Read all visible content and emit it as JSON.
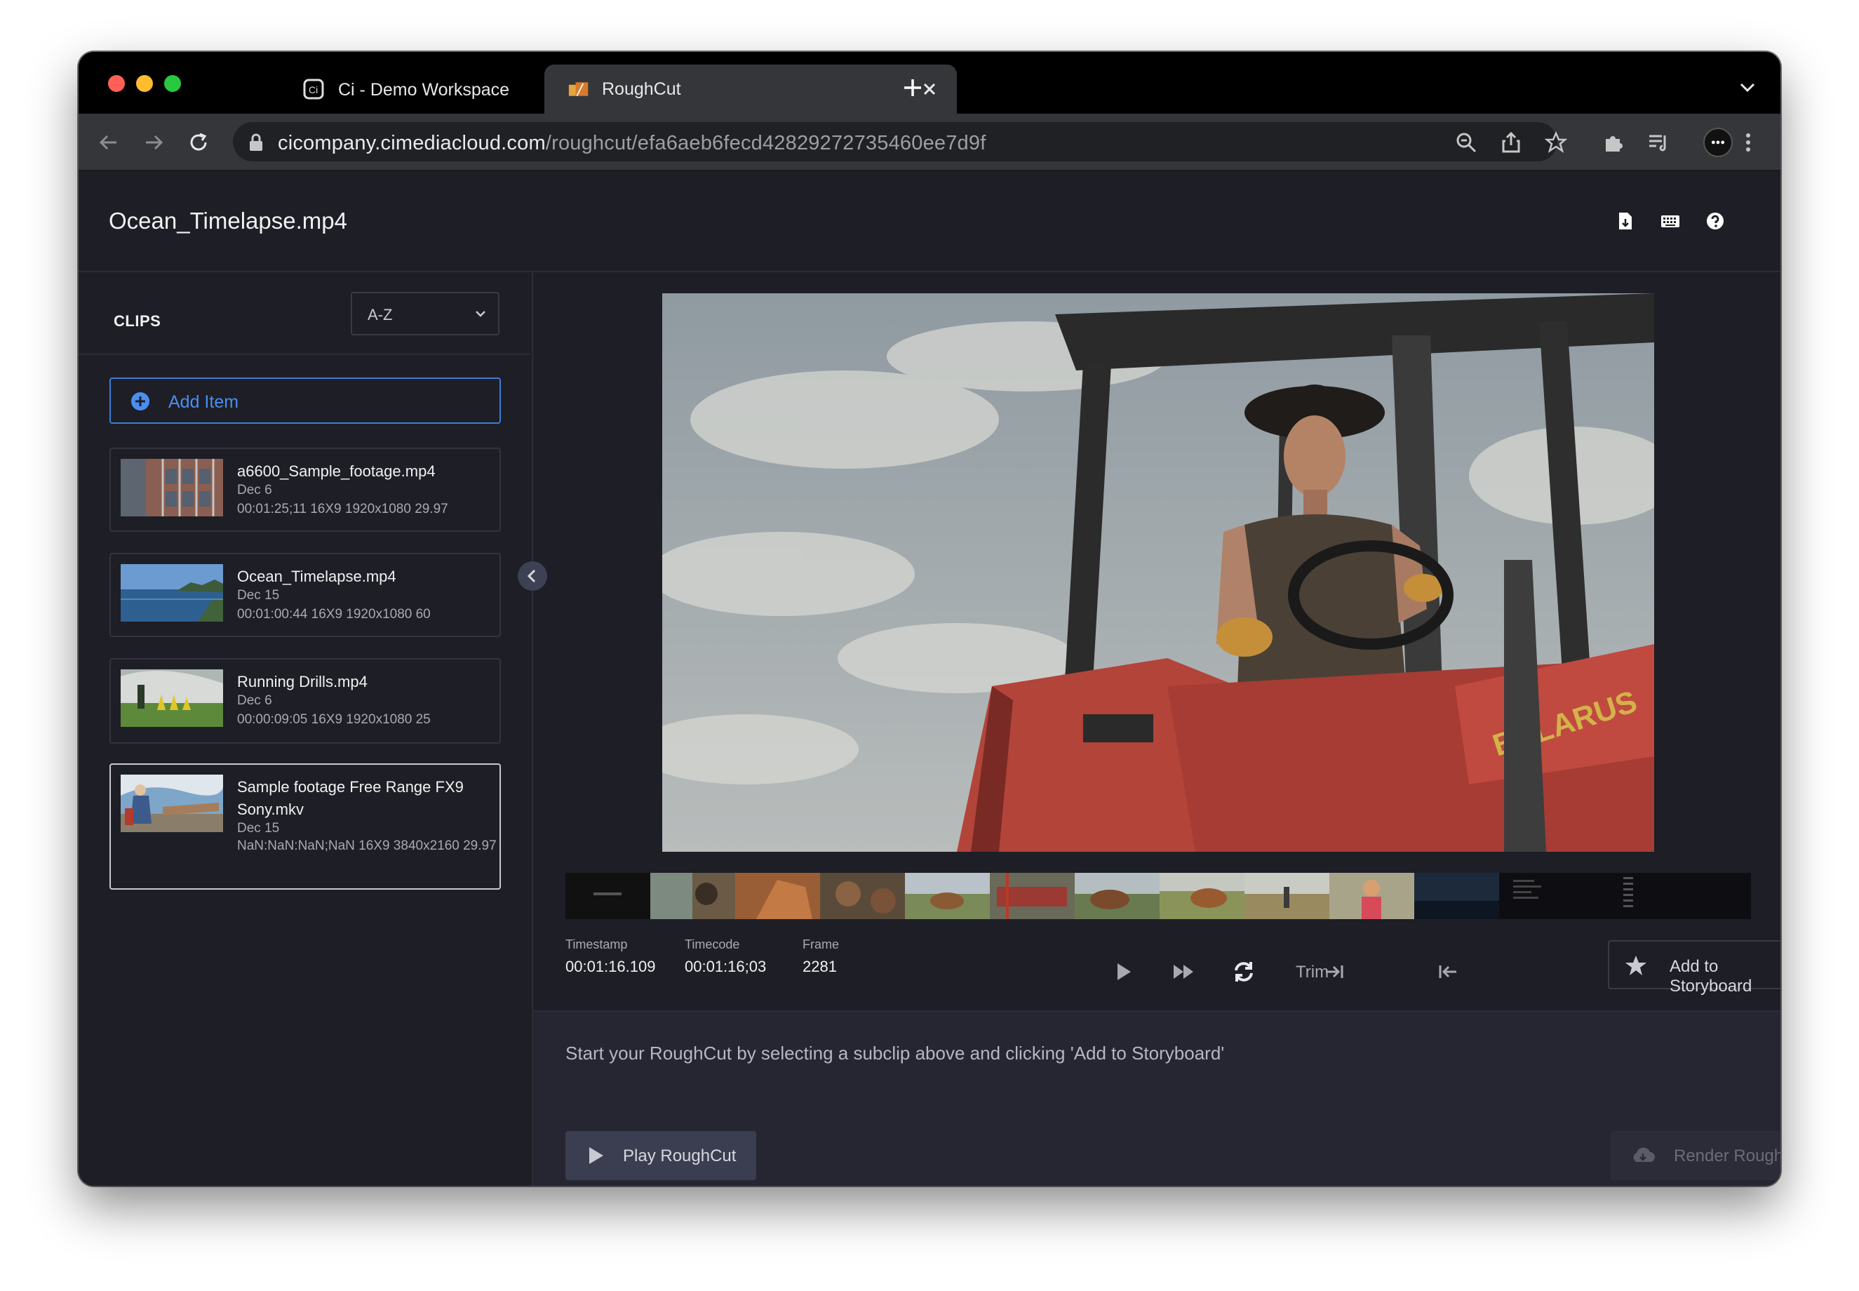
{
  "browser": {
    "tabs": [
      {
        "title": "Ci - Demo Workspace",
        "active": false
      },
      {
        "title": "RoughCut",
        "active": true
      }
    ],
    "url_host": "cicompany.cimediacloud.com",
    "url_path": "/roughcut/efa6aeb6fecd42829272735460ee7d9f"
  },
  "header": {
    "title": "Ocean_Timelapse.mp4"
  },
  "sidebar": {
    "clips_label": "CLIPS",
    "sort_value": "A-Z",
    "add_item_label": "Add Item",
    "clips": [
      {
        "name": "a6600_Sample_footage.mp4",
        "date": "Dec 6",
        "meta": "00:01:25;11   16X9   1920x1080   29.97"
      },
      {
        "name": "Ocean_Timelapse.mp4",
        "date": "Dec 15",
        "meta": "00:01:00:44   16X9   1920x1080   60"
      },
      {
        "name": "Running Drills.mp4",
        "date": "Dec 6",
        "meta": "00:00:09:05   16X9   1920x1080   25"
      },
      {
        "name": "Sample footage Free Range FX9 Sony.mkv",
        "date": "Dec 15",
        "meta": "NaN:NaN:NaN;NaN   16X9   3840x2160   29.97"
      }
    ]
  },
  "player": {
    "timestamp_label": "Timestamp",
    "timestamp_value": "00:01:16.109",
    "timecode_label": "Timecode",
    "timecode_value": "00:01:16;03",
    "frame_label": "Frame",
    "frame_value": "2281",
    "trim_label": "Trim",
    "add_to_storyboard_label": "Add to Storyboard"
  },
  "roughcut": {
    "hint": "Start your RoughCut by selecting a subclip above and clicking 'Add to Storyboard'",
    "play_label": "Play RoughCut",
    "render_label": "Render RoughCut"
  },
  "colors": {
    "accent": "#3a7fd8",
    "background": "#1e1e26",
    "panel": "#262632"
  }
}
